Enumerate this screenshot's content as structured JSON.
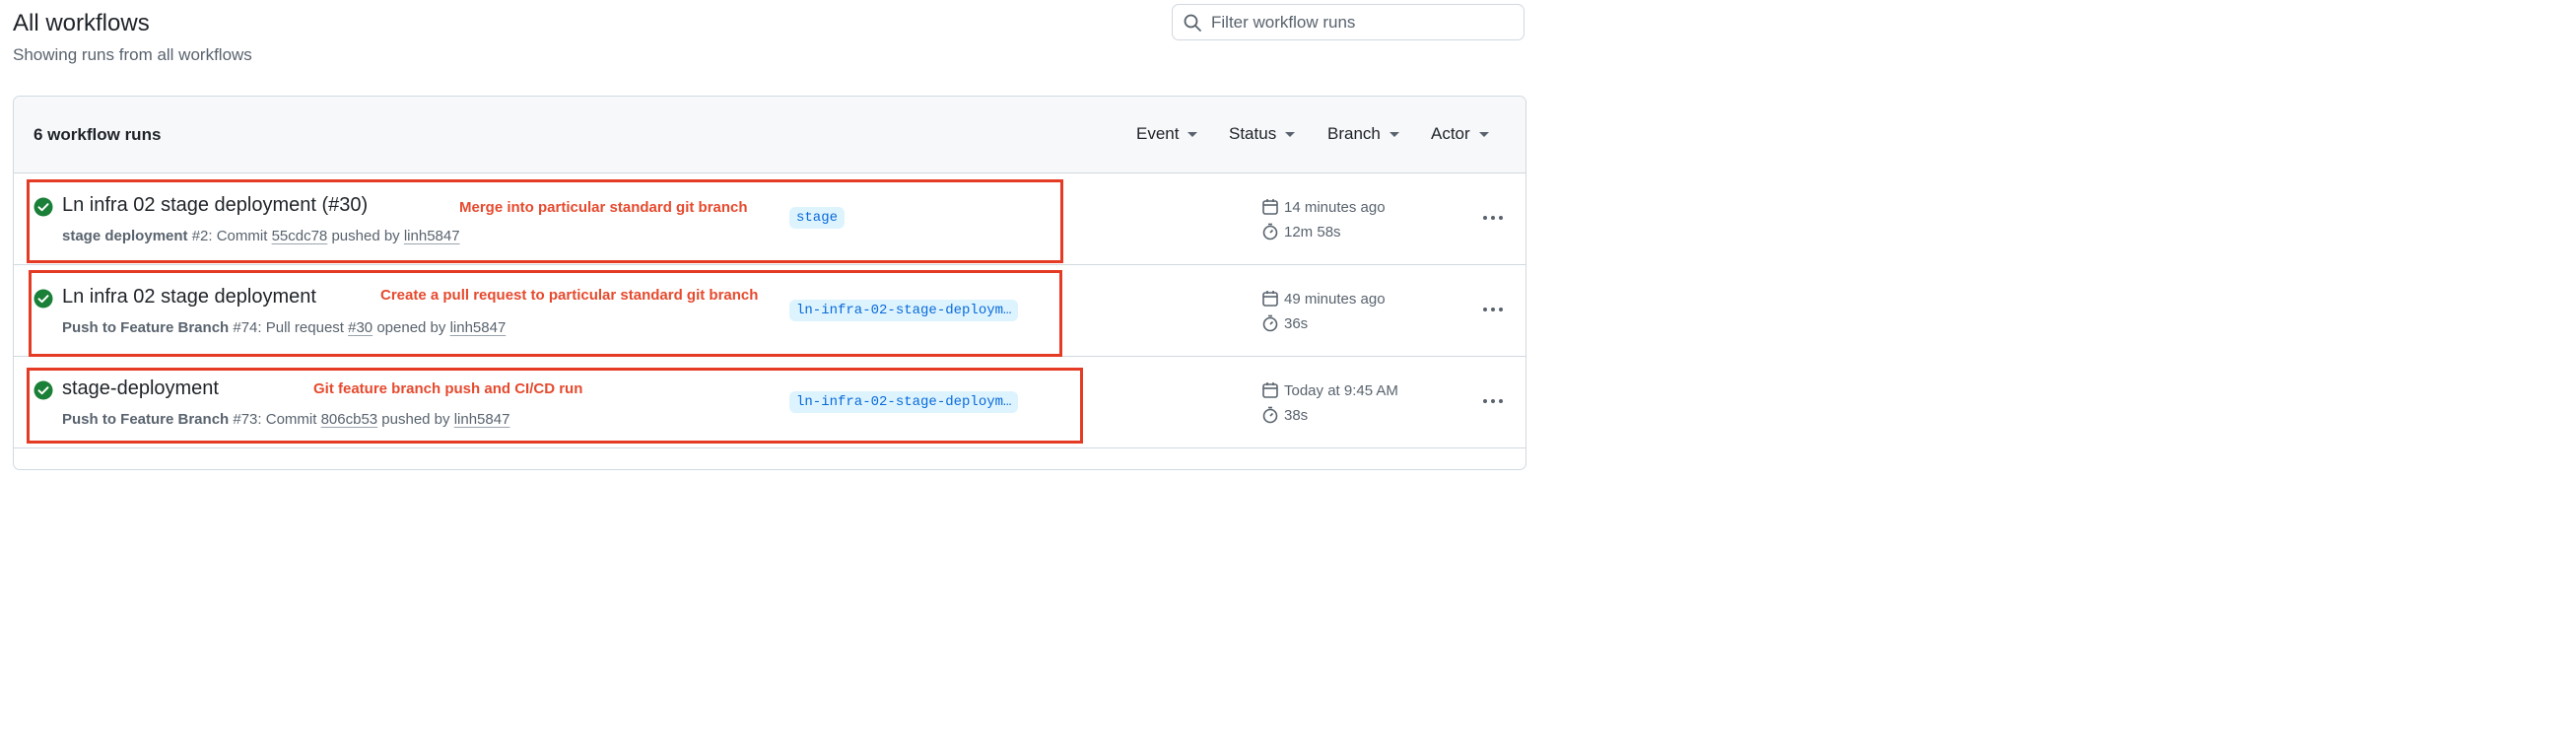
{
  "header": {
    "title": "All workflows",
    "subtitle": "Showing runs from all workflows"
  },
  "search": {
    "placeholder": "Filter workflow runs",
    "icon": "search-icon"
  },
  "list_header": {
    "count_label": "6 workflow runs",
    "filters": [
      "Event",
      "Status",
      "Branch",
      "Actor"
    ]
  },
  "runs": [
    {
      "title": "Ln infra 02 stage deployment (#30)",
      "workflow": "stage deployment",
      "number": "#2",
      "action_prefix": ": Commit ",
      "ref": "55cdc78",
      "action_suffix": " pushed by ",
      "actor": "linh5847",
      "branch": "stage",
      "time": "14 minutes ago",
      "duration": "12m 58s",
      "status": "success",
      "annotation": "Merge into particular standard git branch"
    },
    {
      "title": "Ln infra 02 stage deployment",
      "workflow": "Push to Feature Branch",
      "number": "#74",
      "action_prefix": ": Pull request ",
      "ref": "#30",
      "action_suffix": " opened by ",
      "actor": "linh5847",
      "branch": "ln-infra-02-stage-deploym…",
      "time": "49 minutes ago",
      "duration": "36s",
      "status": "success",
      "annotation": "Create a pull request to particular standard git branch"
    },
    {
      "title": "stage-deployment",
      "workflow": "Push to Feature Branch",
      "number": "#73",
      "action_prefix": ": Commit ",
      "ref": "806cb53",
      "action_suffix": " pushed by ",
      "actor": "linh5847",
      "branch": "ln-infra-02-stage-deploym…",
      "time": "Today at 9:45 AM",
      "duration": "38s",
      "status": "success",
      "annotation": "Git feature branch push and CI/CD run"
    }
  ],
  "colors": {
    "success": "#1a7f37",
    "annotation": "#e53a24",
    "branch_bg": "#ddf4ff",
    "branch_fg": "#0969da"
  }
}
